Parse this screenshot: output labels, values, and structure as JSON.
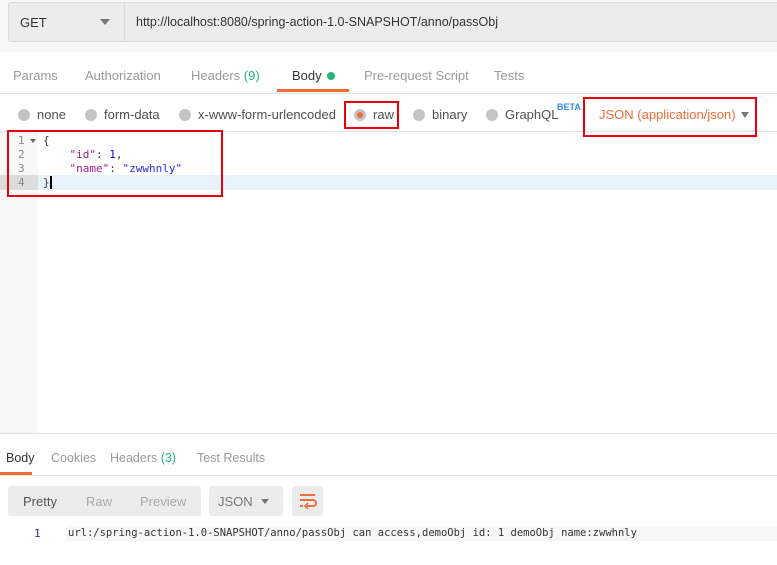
{
  "request": {
    "method": "GET",
    "url": "http://localhost:8080/spring-action-1.0-SNAPSHOT/anno/passObj"
  },
  "tabs": [
    {
      "label": "Params"
    },
    {
      "label": "Authorization"
    },
    {
      "label": "Headers",
      "count": "(9)"
    },
    {
      "label": "Body"
    },
    {
      "label": "Pre-request Script"
    },
    {
      "label": "Tests"
    }
  ],
  "body_types": [
    "none",
    "form-data",
    "x-www-form-urlencoded",
    "raw",
    "binary",
    "GraphQL"
  ],
  "selected_body_type": "raw",
  "beta": "BETA",
  "content_type": "JSON (application/json)",
  "editor": {
    "line_numbers": [
      "1",
      "2",
      "3",
      "4"
    ],
    "open": "{",
    "id_key": "\"id\"",
    "id_val": "1",
    "name_key": "\"name\"",
    "name_val": "\"zwwhnly\"",
    "close": "}"
  },
  "response": {
    "tabs": [
      {
        "label": "Body"
      },
      {
        "label": "Cookies"
      },
      {
        "label": "Headers",
        "count": "(3)"
      },
      {
        "label": "Test Results"
      }
    ],
    "views": [
      "Pretty",
      "Raw",
      "Preview"
    ],
    "format": "JSON",
    "line_number": "1",
    "body": "url:/spring-action-1.0-SNAPSHOT/anno/passObj can access,demoObj id: 1 demoObj name:zwwhnly"
  },
  "colors": {
    "accent": "#f26b3a",
    "green": "#26b47f",
    "highlight": "#e8000b"
  }
}
